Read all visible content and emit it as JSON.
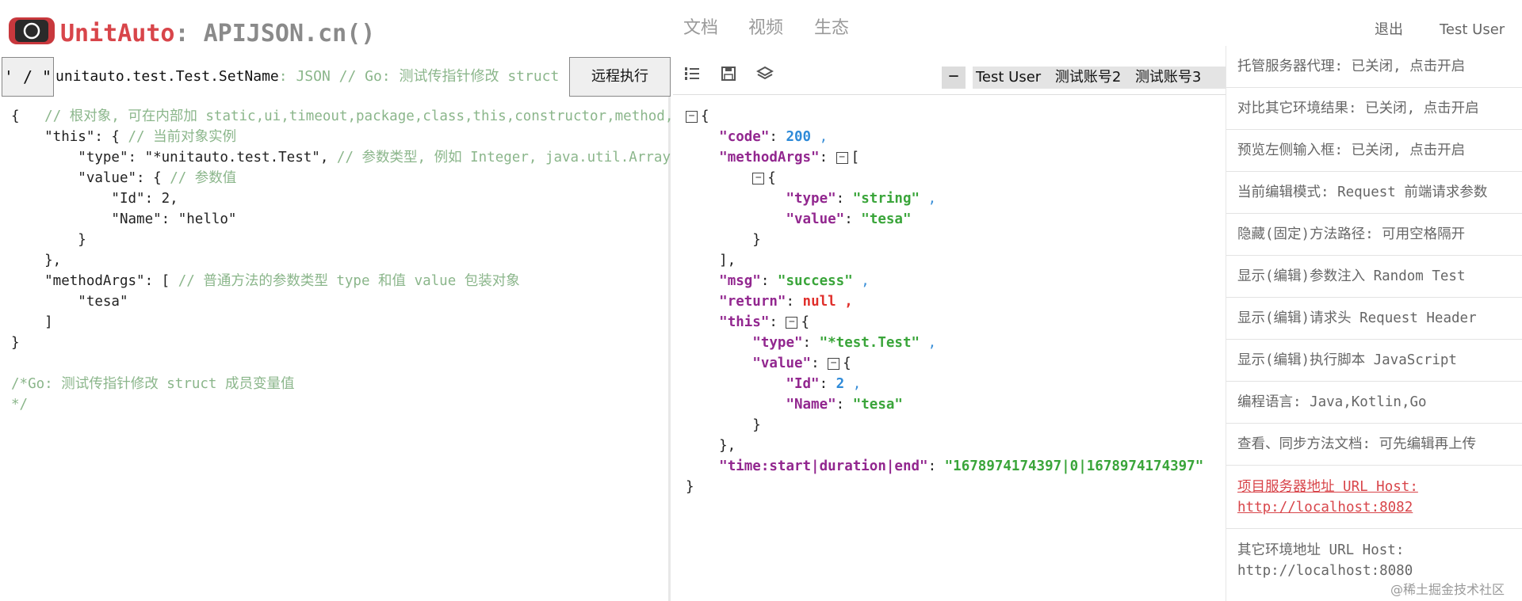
{
  "header": {
    "brand_name": "UnitAuto",
    "brand_suffix": ": APIJSON.cn()",
    "nav": [
      "文档",
      "视频",
      "生态"
    ],
    "logout_label": "退出",
    "user_label": "Test User"
  },
  "request": {
    "quote_label": "' / \"",
    "method_name": "unitauto.test.Test.SetName",
    "method_hint": ": JSON  // Go: 测试传指针修改 struct",
    "run_label": "远程执行"
  },
  "response_toolbar": {
    "collapse_label": "−",
    "accounts": [
      "Test User",
      "测试账号2",
      "测试账号3"
    ]
  },
  "right_menu": [
    "托管服务器代理: 已关闭, 点击开启",
    "对比其它环境结果: 已关闭, 点击开启",
    "预览左侧输入框: 已关闭, 点击开启",
    "当前编辑模式: Request 前端请求参数",
    "隐藏(固定)方法路径: 可用空格隔开",
    "显示(编辑)参数注入 Random Test",
    "显示(编辑)请求头 Request Header",
    "显示(编辑)执行脚本 JavaScript",
    "编程语言: Java,Kotlin,Go",
    "查看、同步方法文档: 可先编辑再上传"
  ],
  "project_host": {
    "label": "项目服务器地址 URL Host:",
    "url": "http://localhost:8082"
  },
  "other_host": {
    "label": "其它环境地址 URL Host:",
    "url": "http://localhost:8080"
  },
  "watermark": "@稀土掘金技术社区",
  "request_lines": [
    [
      [
        "{   ",
        ""
      ],
      [
        "// 根对象, 可在内部加 static,ui,timeout,package,class,this,constructor,method,",
        "cm"
      ]
    ],
    [
      [
        "    \"this\": { ",
        ""
      ],
      [
        "// 当前对象实例",
        "cm"
      ]
    ],
    [
      [
        "        \"type\": \"*unitauto.test.Test\", ",
        ""
      ],
      [
        "// 参数类型, 例如 Integer, java.util.ArrayList",
        "cm"
      ]
    ],
    [
      [
        "        \"value\": { ",
        ""
      ],
      [
        "// 参数值",
        "cm"
      ]
    ],
    [
      [
        "            \"Id\": 2,",
        ""
      ]
    ],
    [
      [
        "            \"Name\": \"hello\"",
        ""
      ]
    ],
    [
      [
        "        }",
        ""
      ]
    ],
    [
      [
        "    },",
        ""
      ]
    ],
    [
      [
        "    \"methodArgs\": [ ",
        ""
      ],
      [
        "// 普通方法的参数类型 type 和值 value 包装对象",
        "cm"
      ]
    ],
    [
      [
        "        \"tesa\"",
        ""
      ]
    ],
    [
      [
        "    ]",
        ""
      ]
    ],
    [
      [
        "}",
        ""
      ]
    ],
    [
      [
        "",
        ""
      ]
    ],
    [
      [
        "/*Go: 测试传指针修改 struct 成员变量值",
        "cm"
      ]
    ],
    [
      [
        "*/",
        "cm"
      ]
    ]
  ],
  "response_lines": [
    [
      [
        "T",
        ""
      ],
      [
        "{",
        ""
      ]
    ],
    [
      [
        "    ",
        ""
      ],
      [
        "\"code\"",
        "k"
      ],
      [
        ": ",
        ""
      ],
      [
        "200",
        "n"
      ],
      [
        " ,",
        "c"
      ]
    ],
    [
      [
        "    ",
        ""
      ],
      [
        "\"methodArgs\"",
        "k"
      ],
      [
        ": ",
        ""
      ],
      [
        "T",
        ""
      ],
      [
        "[",
        ""
      ]
    ],
    [
      [
        "        ",
        ""
      ],
      [
        "T",
        ""
      ],
      [
        "{",
        ""
      ]
    ],
    [
      [
        "            ",
        ""
      ],
      [
        "\"type\"",
        "k"
      ],
      [
        ": ",
        ""
      ],
      [
        "\"string\"",
        "s"
      ],
      [
        " ,",
        "c"
      ]
    ],
    [
      [
        "            ",
        ""
      ],
      [
        "\"value\"",
        "k"
      ],
      [
        ": ",
        ""
      ],
      [
        "\"tesa\"",
        "s"
      ]
    ],
    [
      [
        "        }",
        ""
      ]
    ],
    [
      [
        "    ],",
        ""
      ]
    ],
    [
      [
        "    ",
        ""
      ],
      [
        "\"msg\"",
        "k"
      ],
      [
        ": ",
        ""
      ],
      [
        "\"success\"",
        "s"
      ],
      [
        " ,",
        "c"
      ]
    ],
    [
      [
        "    ",
        ""
      ],
      [
        "\"return\"",
        "k"
      ],
      [
        ": ",
        ""
      ],
      [
        "null",
        "nl"
      ],
      [
        " ,",
        "nl"
      ]
    ],
    [
      [
        "    ",
        ""
      ],
      [
        "\"this\"",
        "k"
      ],
      [
        ": ",
        ""
      ],
      [
        "T",
        ""
      ],
      [
        "{",
        ""
      ]
    ],
    [
      [
        "        ",
        ""
      ],
      [
        "\"type\"",
        "k"
      ],
      [
        ": ",
        ""
      ],
      [
        "\"*test.Test\"",
        "s"
      ],
      [
        " ,",
        "c"
      ]
    ],
    [
      [
        "        ",
        ""
      ],
      [
        "\"value\"",
        "k"
      ],
      [
        ": ",
        ""
      ],
      [
        "T",
        ""
      ],
      [
        "{",
        ""
      ]
    ],
    [
      [
        "            ",
        ""
      ],
      [
        "\"Id\"",
        "k"
      ],
      [
        ": ",
        ""
      ],
      [
        "2",
        "n"
      ],
      [
        " ,",
        "c"
      ]
    ],
    [
      [
        "            ",
        ""
      ],
      [
        "\"Name\"",
        "k"
      ],
      [
        ": ",
        ""
      ],
      [
        "\"tesa\"",
        "s"
      ]
    ],
    [
      [
        "        }",
        ""
      ]
    ],
    [
      [
        "    },",
        ""
      ]
    ],
    [
      [
        "    ",
        ""
      ],
      [
        "\"time:start|duration|end\"",
        "k"
      ],
      [
        ": ",
        ""
      ],
      [
        "\"1678974174397|0|1678974174397\"",
        "s"
      ]
    ],
    [
      [
        "}",
        ""
      ]
    ]
  ]
}
